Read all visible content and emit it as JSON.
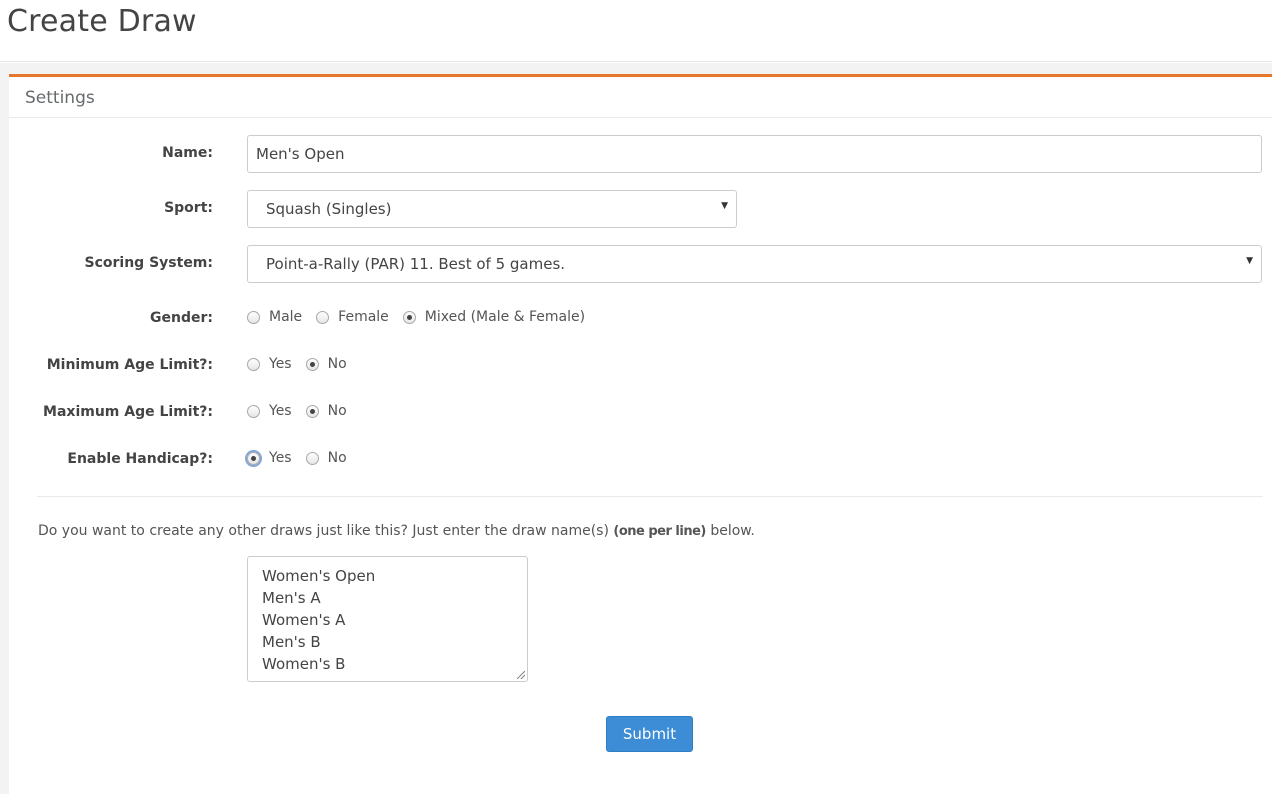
{
  "page": {
    "title": "Create Draw"
  },
  "panel": {
    "title": "Settings",
    "accent_color": "#e8772e"
  },
  "form": {
    "name": {
      "label": "Name:",
      "value": "Men's Open"
    },
    "sport": {
      "label": "Sport:",
      "value": "Squash (Singles)"
    },
    "scoring": {
      "label": "Scoring System:",
      "value": "Point-a-Rally (PAR) 11. Best of 5 games."
    },
    "gender": {
      "label": "Gender:",
      "options": [
        "Male",
        "Female",
        "Mixed (Male & Female)"
      ],
      "selected": "Mixed (Male & Female)"
    },
    "min_age": {
      "label": "Minimum Age Limit?:",
      "options": [
        "Yes",
        "No"
      ],
      "selected": "No"
    },
    "max_age": {
      "label": "Maximum Age Limit?:",
      "options": [
        "Yes",
        "No"
      ],
      "selected": "No"
    },
    "handicap": {
      "label": "Enable Handicap?:",
      "options": [
        "Yes",
        "No"
      ],
      "selected": "Yes"
    }
  },
  "other_draws": {
    "help_prefix": "Do you want to create any other draws just like this? Just enter the draw name(s)",
    "help_bold": "(one per line)",
    "help_suffix": "below.",
    "lines": [
      "Women's Open",
      "Men's A",
      "Women's A",
      "Men's B",
      "Women's B"
    ]
  },
  "submit": {
    "label": "Submit",
    "color": "#3c8dd5"
  }
}
